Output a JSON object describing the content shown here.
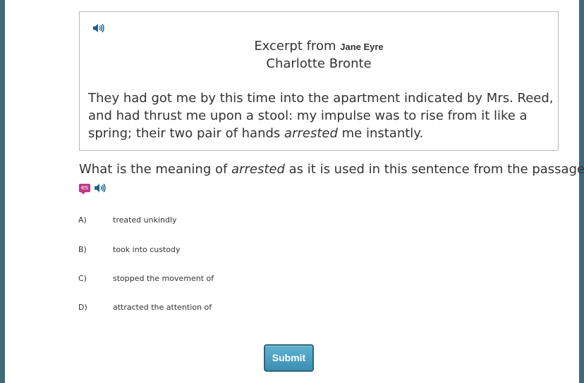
{
  "passage": {
    "heading_prefix": "Excerpt from",
    "work_title": "Jane Eyre",
    "author": "Charlotte Bronte",
    "text_before": "They had got me by this time into the apartment indicated by Mrs. Reed, and had thrust me upon a stool: my impulse was to rise from it like a spring; their two pair of hands",
    "text_emphasis": "arrested",
    "text_after": "me instantly.",
    "audio_icon": "speaker-icon"
  },
  "question": {
    "text_before": "What is the meaning of",
    "text_emphasis": "arrested",
    "text_after": "as it is used in this sentence from the passage?",
    "translate_badge": "es",
    "audio_icon": "speaker-icon"
  },
  "answers": [
    {
      "letter": "A)",
      "text": "treated unkindly"
    },
    {
      "letter": "B)",
      "text": "took into custody"
    },
    {
      "letter": "C)",
      "text": "stopped the movement of"
    },
    {
      "letter": "D)",
      "text": "attracted the attention of"
    }
  ],
  "submit_label": "Submit",
  "colors": {
    "frame": "#3f6a7c",
    "submit": "#4a9fc2",
    "badge": "#c0398b",
    "text": "#333333"
  }
}
